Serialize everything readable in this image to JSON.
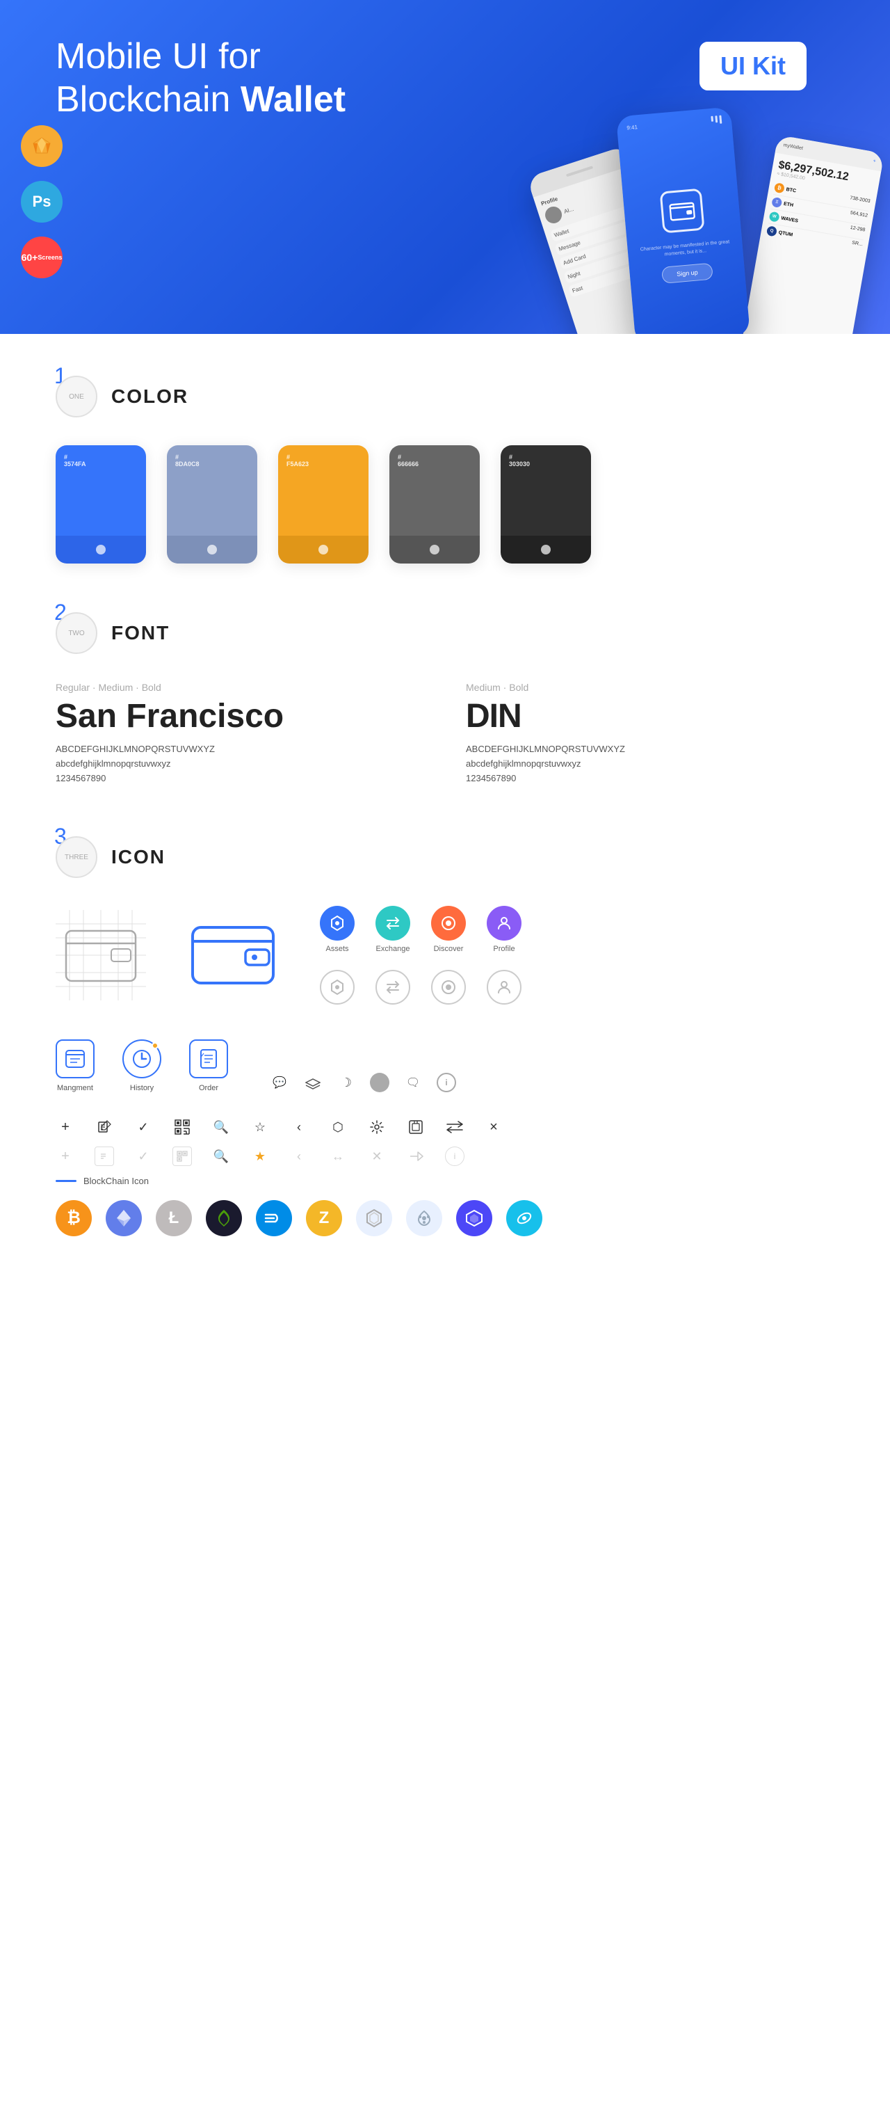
{
  "hero": {
    "title_regular": "Mobile UI for Blockchain ",
    "title_bold": "Wallet",
    "badge": "UI Kit",
    "tool_sketch": "Sketch",
    "tool_ps": "Ps",
    "screens": "60+\nScreens"
  },
  "sections": {
    "color": {
      "number": "1",
      "label": "ONE",
      "title": "COLOR",
      "swatches": [
        {
          "hex": "#3574FA",
          "code": "#\n3574FA"
        },
        {
          "hex": "#8DA0C8",
          "code": "#\n8DA0C8"
        },
        {
          "hex": "#F5A623",
          "code": "#\nF5A623"
        },
        {
          "hex": "#666666",
          "code": "#\n666666"
        },
        {
          "hex": "#303030",
          "code": "#\n303030"
        }
      ]
    },
    "font": {
      "number": "2",
      "label": "TWO",
      "title": "FONT",
      "fonts": [
        {
          "style": "Regular · Medium · Bold",
          "name": "San Francisco",
          "uppercase": "ABCDEFGHIJKLMNOPQRSTUVWXYZ",
          "lowercase": "abcdefghijklmnopqrstuvwxyz",
          "numbers": "1234567890"
        },
        {
          "style": "Medium · Bold",
          "name": "DIN",
          "uppercase": "ABCDEFGHIJKLMNOPQRSTUVWXYZ",
          "lowercase": "abcdefghijklmnopqrstuvwxyz",
          "numbers": "1234567890"
        }
      ]
    },
    "icon": {
      "number": "3",
      "label": "THREE",
      "title": "ICON",
      "nav_icons": [
        {
          "label": "Assets",
          "type": "diamond"
        },
        {
          "label": "Exchange",
          "type": "exchange"
        },
        {
          "label": "Discover",
          "type": "discover"
        },
        {
          "label": "Profile",
          "type": "profile"
        }
      ],
      "bottom_icons": [
        {
          "label": "Mangment",
          "type": "management"
        },
        {
          "label": "History",
          "type": "history"
        },
        {
          "label": "Order",
          "type": "order"
        }
      ],
      "blockchain_label": "BlockChain Icon"
    }
  }
}
